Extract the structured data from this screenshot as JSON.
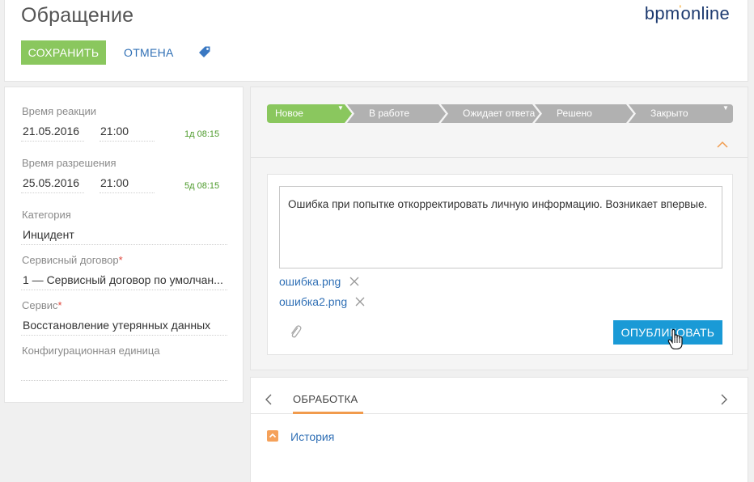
{
  "header": {
    "title": "Обращение",
    "logo_left": "bpm",
    "logo_dot": "'",
    "logo_right": "online",
    "save_label": "СОХРАНИТЬ",
    "cancel_label": "ОТМЕНА"
  },
  "fields": {
    "reaction_label": "Время реакции",
    "reaction_date": "21.05.2016",
    "reaction_time": "21:00",
    "reaction_duration": "1д 08:15",
    "resolution_label": "Время разрешения",
    "resolution_date": "25.05.2016",
    "resolution_time": "21:00",
    "resolution_duration": "5д 08:15",
    "category_label": "Категория",
    "category_value": "Инцидент",
    "contract_label": "Сервисный договор",
    "contract_value": "1 — Сервисный договор по умолчан...",
    "service_label": "Сервис",
    "service_value": "Восстановление утерянных данных",
    "ci_label": "Конфигурационная единица",
    "ci_value": "",
    "required_mark": "*"
  },
  "stages": [
    {
      "label": "Новое",
      "active": true
    },
    {
      "label": "В работе",
      "active": false
    },
    {
      "label": "Ожидает ответа",
      "active": false
    },
    {
      "label": "Решено",
      "active": false
    },
    {
      "label": "Закрыто",
      "active": false
    }
  ],
  "feed": {
    "message": "Ошибка при попытке откорректировать личную информацию. Возникает впервые.",
    "attachments": [
      "ошибка.png",
      "ошибка2.png"
    ],
    "publish_label": "ОПУБЛИКОВАТЬ"
  },
  "tabs": {
    "active_label": "ОБРАБОТКА",
    "history_label": "История"
  },
  "colors": {
    "accent_green": "#8ac75e",
    "stage_inactive": "#b1b1b1",
    "publish_blue": "#1a9ad6",
    "link_blue": "#2f6fb5",
    "tab_underline": "#f19b4d"
  }
}
